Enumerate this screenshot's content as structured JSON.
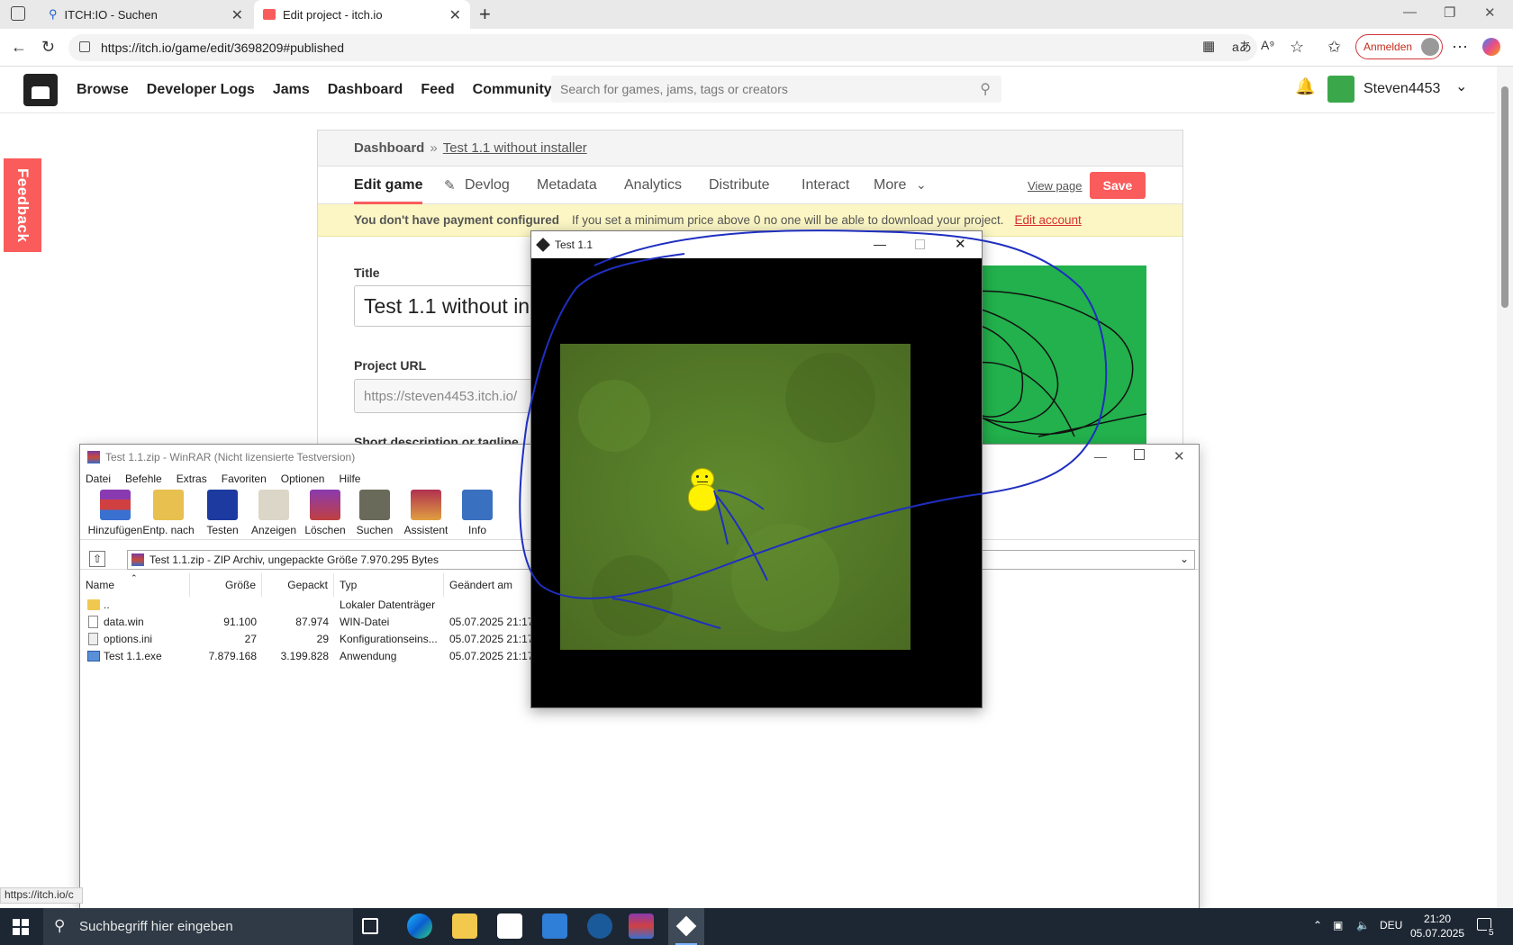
{
  "browser": {
    "tabs": [
      {
        "title": "ITCH:IO - Suchen",
        "active": false
      },
      {
        "title": "Edit project - itch.io",
        "active": true
      }
    ],
    "new_tab": "+",
    "url": "https://itch.io/game/edit/3698209#published",
    "anmelden": "Anmelden",
    "status_url": "https://itch.io/c"
  },
  "itch": {
    "nav": [
      "Browse",
      "Developer Logs",
      "Jams",
      "Dashboard",
      "Feed",
      "Community"
    ],
    "search_placeholder": "Search for games, jams, tags or creators",
    "username": "Steven4453",
    "feedback": "Feedback"
  },
  "edit": {
    "breadcrumb_root": "Dashboard",
    "breadcrumb_sep": "»",
    "breadcrumb_project": "Test 1.1 without installer",
    "tabs": [
      "Edit game",
      "Devlog",
      "Metadata",
      "Analytics",
      "Distribute",
      "Interact",
      "More"
    ],
    "view_page": "View page",
    "save": "Save",
    "notice_bold": "You don't have payment configured",
    "notice_text": "If you set a minimum price above 0 no one will be able to download your project.",
    "notice_link": "Edit account",
    "title_label": "Title",
    "title_value": "Test 1.1 without in",
    "url_label": "Project URL",
    "url_value": "https://steven4453.itch.io/",
    "short_desc_label": "Short description or tagline"
  },
  "winrar": {
    "title": "Test 1.1.zip - WinRAR (Nicht lizensierte Testversion)",
    "menu": [
      "Datei",
      "Befehle",
      "Extras",
      "Favoriten",
      "Optionen",
      "Hilfe"
    ],
    "tools": [
      "Hinzufügen",
      "Entp. nach",
      "Testen",
      "Anzeigen",
      "Löschen",
      "Suchen",
      "Assistent",
      "Info"
    ],
    "path": "Test 1.1.zip - ZIP Archiv, ungepackte Größe 7.970.295 Bytes",
    "columns": [
      "Name",
      "Größe",
      "Gepackt",
      "Typ",
      "Geändert am"
    ],
    "rows": [
      {
        "name": "..",
        "size": "",
        "packed": "",
        "type": "Lokaler Datenträger",
        "date": ""
      },
      {
        "name": "data.win",
        "size": "91.100",
        "packed": "87.974",
        "type": "WIN-Datei",
        "date": "05.07.2025 21:17"
      },
      {
        "name": "options.ini",
        "size": "27",
        "packed": "29",
        "type": "Konfigurationseins...",
        "date": "05.07.2025 21:17"
      },
      {
        "name": "Test 1.1.exe",
        "size": "7.879.168",
        "packed": "3.199.828",
        "type": "Anwendung",
        "date": "05.07.2025 21:17"
      }
    ]
  },
  "game": {
    "title": "Test 1.1"
  },
  "taskbar": {
    "search_placeholder": "Suchbegriff hier eingeben",
    "lang": "DEU",
    "time": "21:20",
    "date": "05.07.2025",
    "notif_count": "5"
  }
}
